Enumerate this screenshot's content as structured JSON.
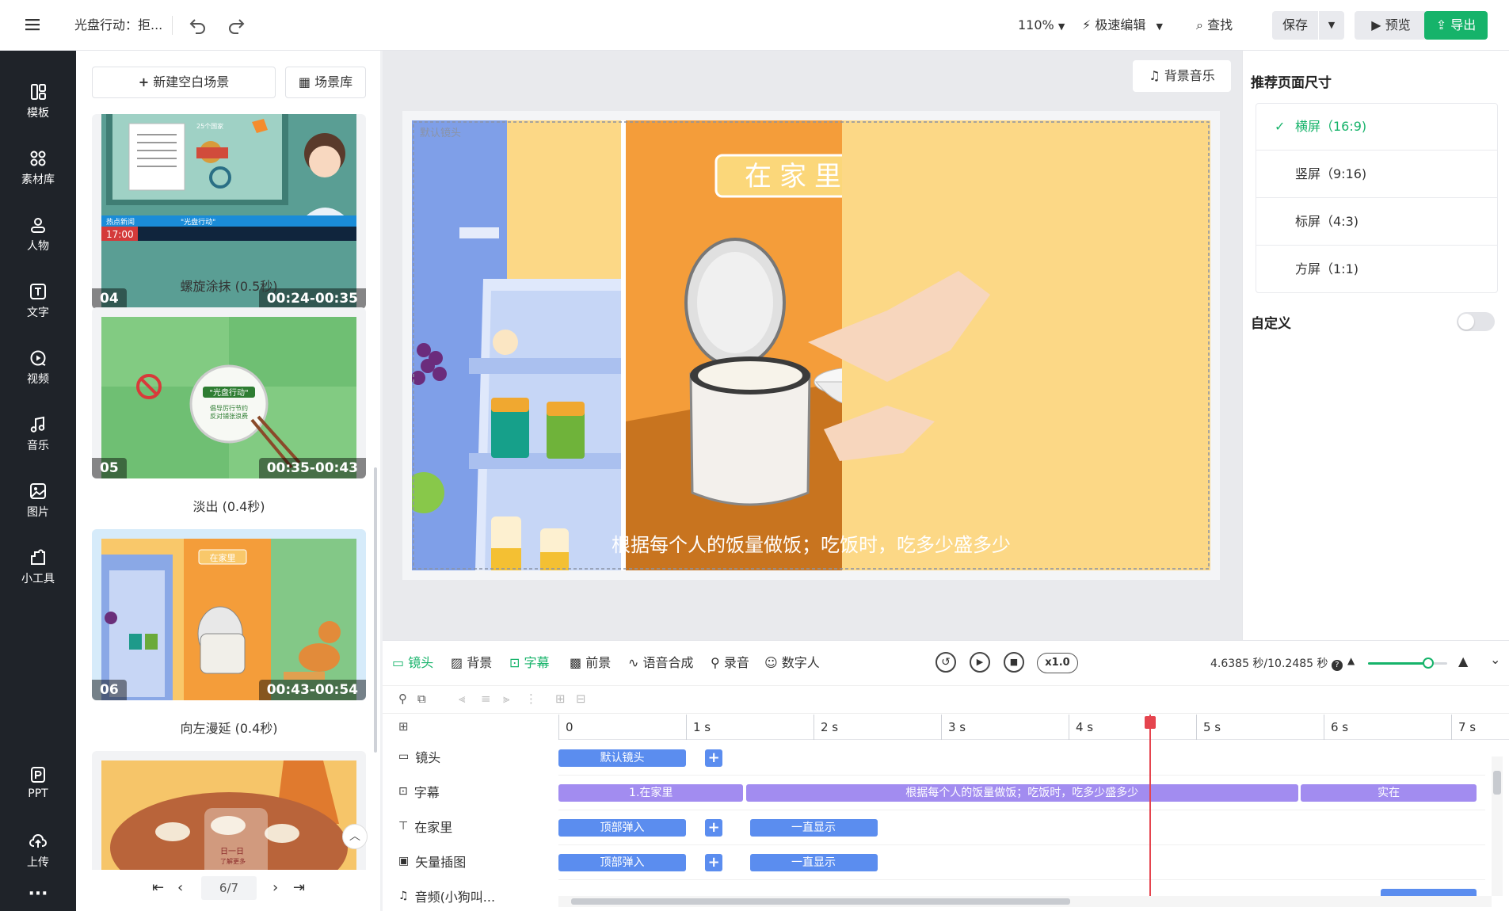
{
  "topbar": {
    "doc_title": "光盘行动：拒...",
    "zoom": "110%",
    "quick_edit": "极速编辑",
    "find": "查找",
    "save": "保存",
    "preview": "预览",
    "export": "导出"
  },
  "rail": {
    "items": [
      {
        "label": "模板",
        "icon": "template-icon"
      },
      {
        "label": "素材库",
        "icon": "library-icon"
      },
      {
        "label": "人物",
        "icon": "person-icon"
      },
      {
        "label": "文字",
        "icon": "text-icon"
      },
      {
        "label": "视频",
        "icon": "video-icon"
      },
      {
        "label": "音乐",
        "icon": "music-icon"
      },
      {
        "label": "图片",
        "icon": "image-icon"
      },
      {
        "label": "小工具",
        "icon": "tools-icon"
      }
    ],
    "bottom": [
      {
        "label": "PPT",
        "icon": "ppt-icon"
      },
      {
        "label": "上传",
        "icon": "upload-icon"
      }
    ],
    "more": "···"
  },
  "scenes": {
    "new_blank": "新建空白场景",
    "library": "场景库",
    "items": [
      {
        "num": "04",
        "time": "00:24-00:35",
        "caption": "螺旋涂抹 (0.5秒)",
        "news_label": "热点新闻",
        "news_text": "\"光盘行动\"",
        "clock": "17:00",
        "board_title": "25个国家"
      },
      {
        "num": "05",
        "time": "00:35-00:43",
        "caption": "淡出 (0.4秒)",
        "plate_title": "\"光盘行动\"",
        "plate_line1": "倡导厉行节约",
        "plate_line2": "反对铺张浪费"
      },
      {
        "num": "06",
        "time": "00:43-00:54",
        "caption": "向左漫延 (0.4秒)",
        "sign": "在家里"
      },
      {
        "num": "",
        "time": "",
        "caption": "",
        "calendar": "日一日",
        "calendar2": "了解更多"
      }
    ],
    "pager": {
      "current": "6/7"
    }
  },
  "canvas": {
    "bg_music": "背景音乐",
    "shot_label": "默认镜头",
    "sign": "在家里",
    "subtitle": "根据每个人的饭量做饭；吃饭时，吃多少盛多少"
  },
  "props": {
    "title": "推荐页面尺寸",
    "options": [
      {
        "label": "横屏（16:9)",
        "selected": true
      },
      {
        "label": "竖屏（9:16)",
        "selected": false
      },
      {
        "label": "标屏（4:3)",
        "selected": false
      },
      {
        "label": "方屏（1:1)",
        "selected": false
      }
    ],
    "custom": "自定义",
    "custom_on": false
  },
  "timeline": {
    "tabs": [
      "镜头",
      "背景",
      "字幕",
      "前景",
      "语音合成",
      "录音",
      "数字人"
    ],
    "speed": "x1.0",
    "time_readout": "4.6385 秒/10.2485 秒",
    "zoom_level": 0.76,
    "playhead_seconds": 4.6385,
    "ruler": [
      "0",
      "1 s",
      "2 s",
      "3 s",
      "4 s",
      "5 s",
      "6 s",
      "7 s"
    ],
    "tracks": [
      {
        "name": "镜头",
        "clips": [
          {
            "text": "默认镜头",
            "start": 0.0,
            "end": 1.0
          }
        ],
        "plus_after": 1.15
      },
      {
        "name": "字幕",
        "clips": [
          {
            "text": "1.在家里",
            "start": 0.0,
            "end": 1.45
          },
          {
            "text": "根据每个人的饭量做饭；吃饭时，吃多少盛多少",
            "start": 1.47,
            "end": 5.8
          },
          {
            "text": "实在",
            "start": 5.82,
            "end": 7.2
          }
        ]
      },
      {
        "name": "在家里",
        "clips": [
          {
            "text": "顶部弹入",
            "start": 0.0,
            "end": 1.0
          },
          {
            "text": "一直显示",
            "start": 1.5,
            "end": 2.5
          }
        ],
        "plus_after": 1.15
      },
      {
        "name": "矢量插图",
        "clips": [
          {
            "text": "顶部弹入",
            "start": 0.0,
            "end": 1.0
          },
          {
            "text": "一直显示",
            "start": 1.5,
            "end": 2.5
          }
        ],
        "plus_after": 1.15
      },
      {
        "name": "音频(小狗叫...",
        "clips": [
          {
            "text": "",
            "start": 6.45,
            "end": 7.2
          }
        ]
      }
    ]
  },
  "colors": {
    "accent_green": "#16b36a",
    "clip_blue": "#5b8def",
    "clip_purple": "#a28cf0",
    "playhead": "#e5444e",
    "rail_bg": "#1f2329"
  }
}
